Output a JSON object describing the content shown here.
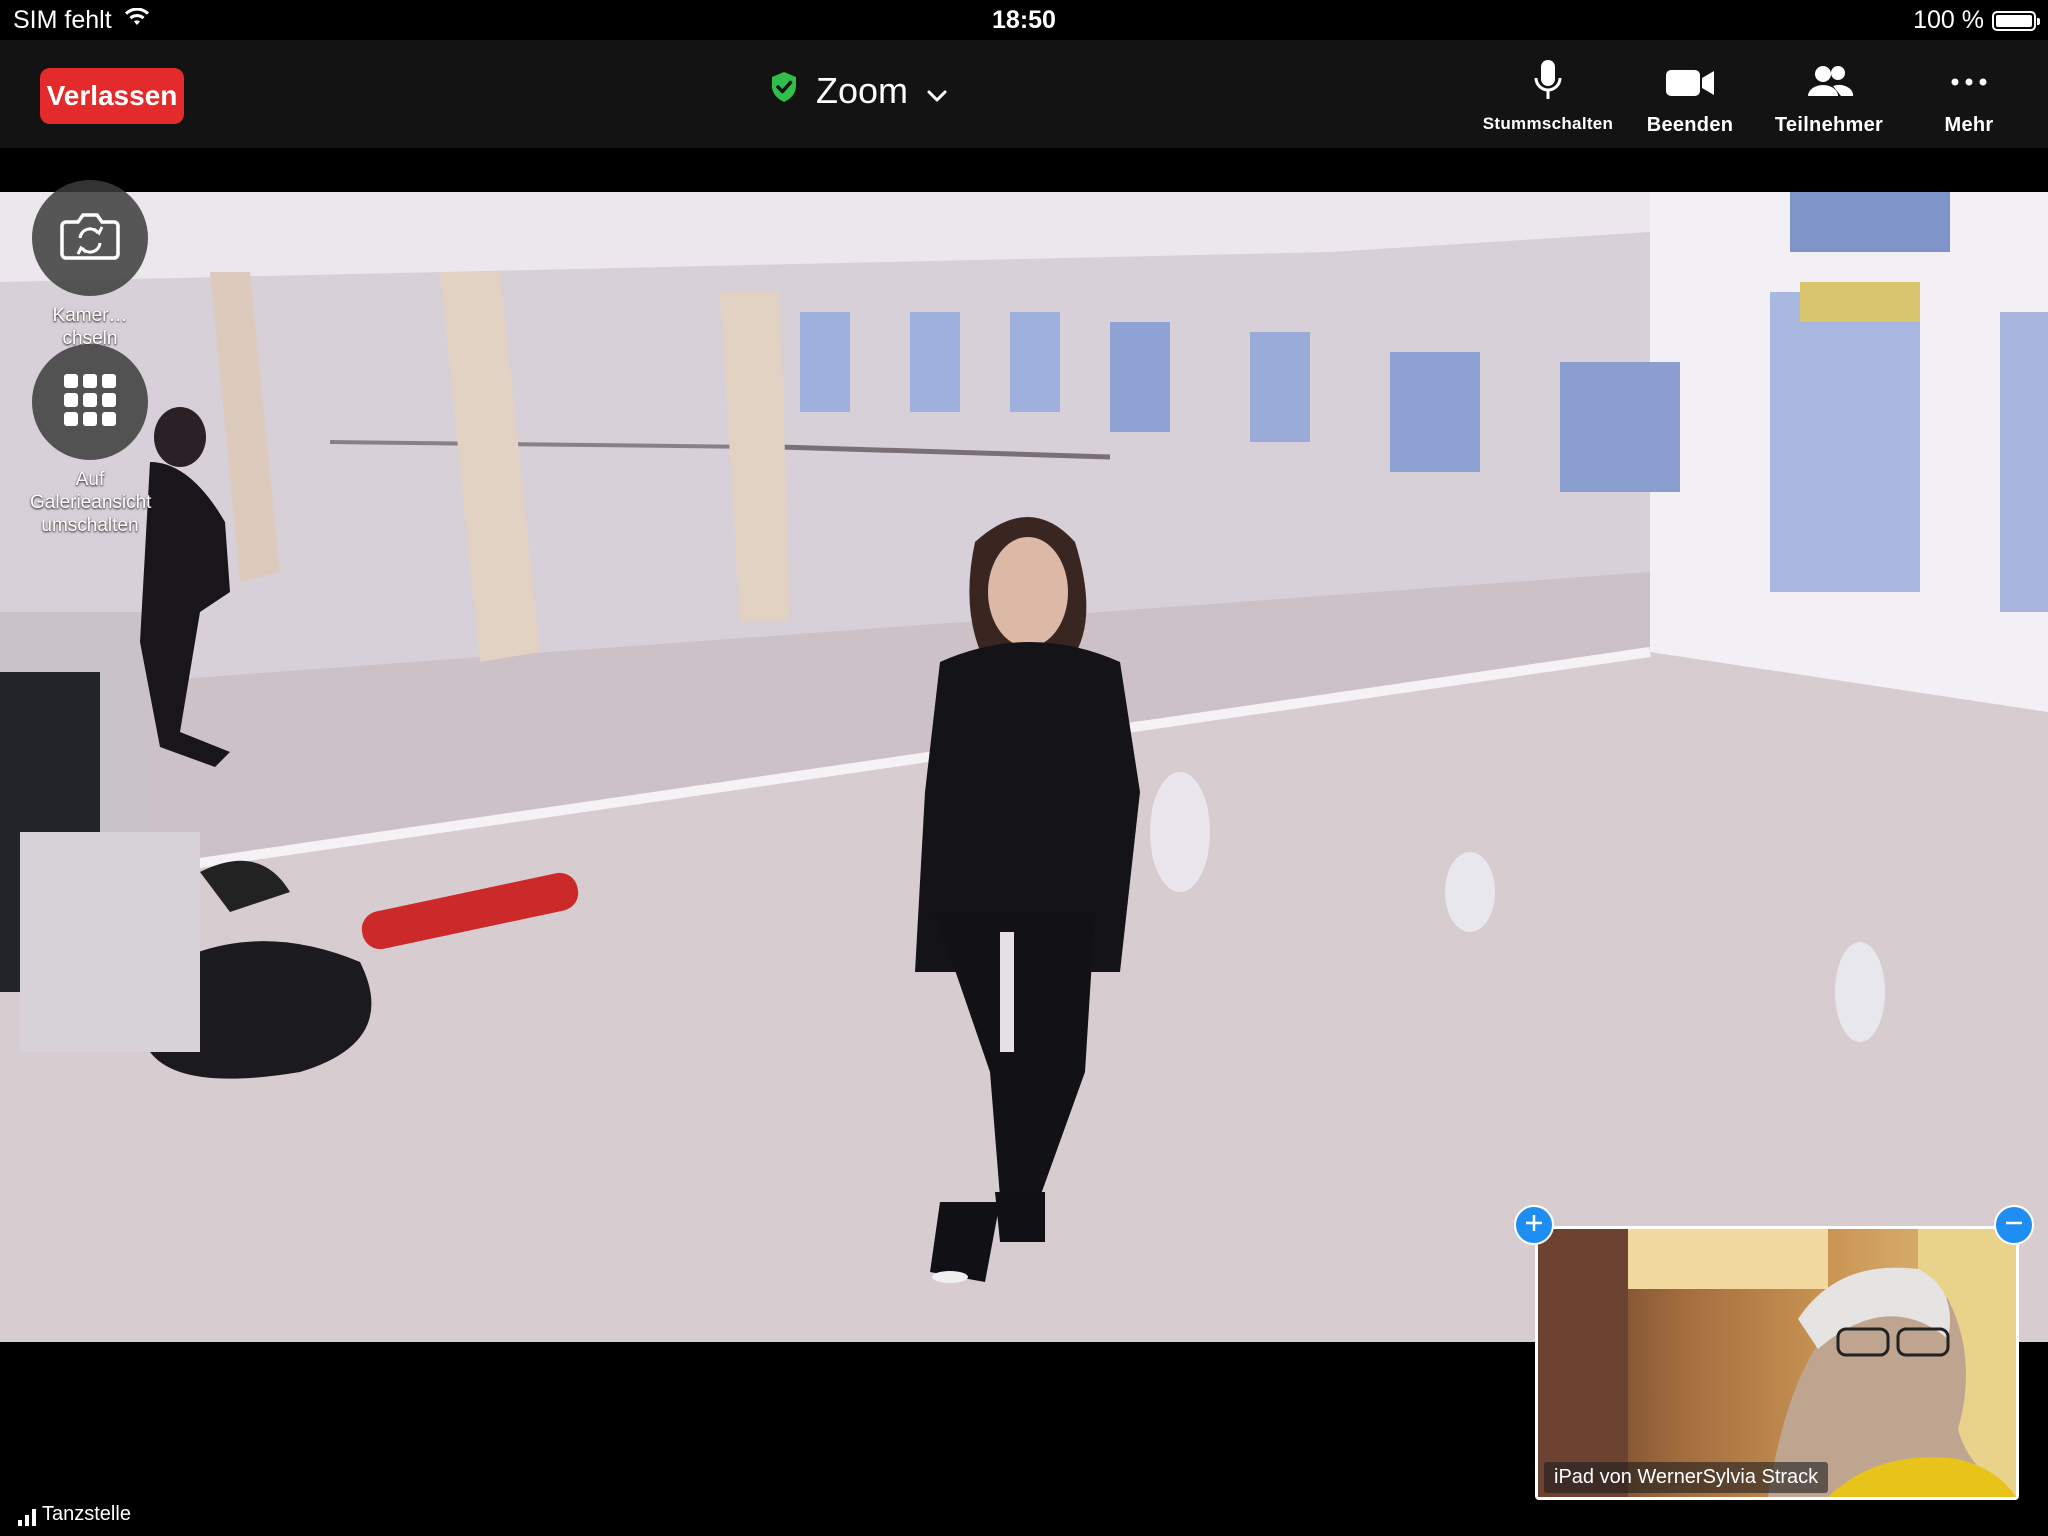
{
  "status_bar": {
    "carrier": "SIM fehlt",
    "time": "18:50",
    "battery": "100 %",
    "battery_level": 1.0,
    "icons": [
      "wifi-icon",
      "battery-icon"
    ]
  },
  "toolbar": {
    "leave_label": "Verlassen",
    "meeting_title": "Zoom",
    "controls": [
      {
        "label": "Stummschalten",
        "icon": "microphone-icon"
      },
      {
        "label": "Beenden",
        "icon": "video-camera-icon"
      },
      {
        "label": "Teilnehmer",
        "icon": "participants-icon"
      },
      {
        "label": "Mehr",
        "icon": "more-dots-icon"
      }
    ]
  },
  "side_buttons": {
    "switch_camera": "Kamer…chseln",
    "gallery_view": "Auf Galerieansicht umschalten"
  },
  "self_view": {
    "name": "iPad von WernerSylvia Strack"
  },
  "connection": {
    "network_label": "Tanzstelle"
  },
  "colors": {
    "leave_button": "#e32b2b",
    "toolbar_bg": "#131313",
    "shield_green": "#2fbf4a",
    "pip_blue": "#1e8ef2"
  }
}
